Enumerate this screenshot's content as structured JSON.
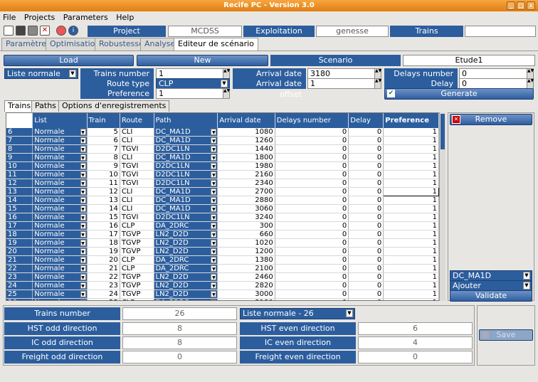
{
  "window": {
    "title": "Recife PC - Version 3.0"
  },
  "menu": [
    "File",
    "Projects",
    "Parameters",
    "Help"
  ],
  "header": {
    "project_label": "Project",
    "project_value": "MCDSS",
    "exploitation_label": "Exploitation",
    "exploitation_value": "genesse",
    "trains_label": "Trains",
    "trains_value": ""
  },
  "tabs": [
    "Paramètres",
    "Optimisation",
    "Robustesse",
    "Analyse",
    "Editeur de scénario"
  ],
  "active_tab": 4,
  "scenario_bar": {
    "load": "Load",
    "new": "New",
    "scenario_label": "Scenario",
    "scenario_value": "Etude1"
  },
  "params": {
    "list_type": "Liste normale",
    "trains_number_label": "Trains number",
    "trains_number": "1",
    "route_type_label": "Route type",
    "route_type": "CLP",
    "preference_label": "Preference",
    "preference": "1",
    "arrival_date_label": "Arrival date",
    "arrival_date": "3180",
    "arrival_offset_label": "Arrival date offset",
    "arrival_offset": "1",
    "delays_number_label": "Delays number",
    "delays_number": "0",
    "delay_label": "Delay",
    "delay": "0",
    "generate": "Generate"
  },
  "subtabs": [
    "Trains",
    "Paths",
    "Options d'enregistrements"
  ],
  "grid": {
    "columns": [
      "List",
      "Train",
      "Route",
      "Path",
      "Arrival date",
      "Delays number",
      "Delay",
      "Preference"
    ],
    "rows": [
      [
        "6",
        "Normale",
        "5",
        "CLI",
        "DC_MA1D",
        "1080",
        "0",
        "0",
        "1"
      ],
      [
        "7",
        "Normale",
        "6",
        "CLI",
        "DC_MA1D",
        "1260",
        "0",
        "0",
        "1"
      ],
      [
        "8",
        "Normale",
        "7",
        "TGVI",
        "D2DC1LN",
        "1440",
        "0",
        "0",
        "1"
      ],
      [
        "9",
        "Normale",
        "8",
        "CLI",
        "DC_MA1D",
        "1800",
        "0",
        "0",
        "1"
      ],
      [
        "10",
        "Normale",
        "9",
        "TGVI",
        "D2DC1LN",
        "1980",
        "0",
        "0",
        "1"
      ],
      [
        "11",
        "Normale",
        "10",
        "TGVI",
        "D2DC1LN",
        "2160",
        "0",
        "0",
        "1"
      ],
      [
        "12",
        "Normale",
        "11",
        "TGVI",
        "D2DC1LN",
        "2340",
        "0",
        "0",
        "1"
      ],
      [
        "13",
        "Normale",
        "12",
        "CLI",
        "DC_MA1D",
        "2700",
        "0",
        "0",
        "1"
      ],
      [
        "14",
        "Normale",
        "13",
        "CLI",
        "DC_MA1D",
        "2880",
        "0",
        "0",
        "1"
      ],
      [
        "15",
        "Normale",
        "14",
        "CLI",
        "DC_MA1D",
        "3060",
        "0",
        "0",
        "1"
      ],
      [
        "16",
        "Normale",
        "15",
        "TGVI",
        "D2DC1LN",
        "3240",
        "0",
        "0",
        "1"
      ],
      [
        "17",
        "Normale",
        "16",
        "CLP",
        "DA_2DRC",
        "300",
        "0",
        "0",
        "1"
      ],
      [
        "18",
        "Normale",
        "17",
        "TGVP",
        "LN2_D2D",
        "660",
        "0",
        "0",
        "1"
      ],
      [
        "19",
        "Normale",
        "18",
        "TGVP",
        "LN2_D2D",
        "1020",
        "0",
        "0",
        "1"
      ],
      [
        "20",
        "Normale",
        "19",
        "TGVP",
        "LN2_D2D",
        "1200",
        "0",
        "0",
        "1"
      ],
      [
        "21",
        "Normale",
        "20",
        "CLP",
        "DA_2DRC",
        "1380",
        "0",
        "0",
        "1"
      ],
      [
        "22",
        "Normale",
        "21",
        "CLP",
        "DA_2DRC",
        "2100",
        "0",
        "0",
        "1"
      ],
      [
        "23",
        "Normale",
        "22",
        "TGVP",
        "LN2_D2D",
        "2460",
        "0",
        "0",
        "1"
      ],
      [
        "24",
        "Normale",
        "23",
        "TGVP",
        "LN2_D2D",
        "2820",
        "0",
        "0",
        "1"
      ],
      [
        "25",
        "Normale",
        "24",
        "TGVP",
        "LN2_D2D",
        "3000",
        "0",
        "0",
        "1"
      ],
      [
        "26",
        "Normale",
        "25",
        "CLP",
        "DA_2DRC",
        "3180",
        "0",
        "0",
        "1"
      ]
    ]
  },
  "side": {
    "remove": "Remove",
    "path_select": "DC_MA1D",
    "action_select": "Ajouter",
    "validate": "Validate"
  },
  "summary": {
    "trains_number_label": "Trains number",
    "trains_number": "26",
    "list_select": "Liste normale - 26",
    "hst_odd_label": "HST odd direction",
    "hst_odd": "8",
    "hst_even_label": "HST even direction",
    "hst_even": "6",
    "ic_odd_label": "IC odd direction",
    "ic_odd": "8",
    "ic_even_label": "IC even direction",
    "ic_even": "4",
    "freight_odd_label": "Freight odd direction",
    "freight_odd": "0",
    "freight_even_label": "Freight even direction",
    "freight_even": "0",
    "save": "Save"
  }
}
